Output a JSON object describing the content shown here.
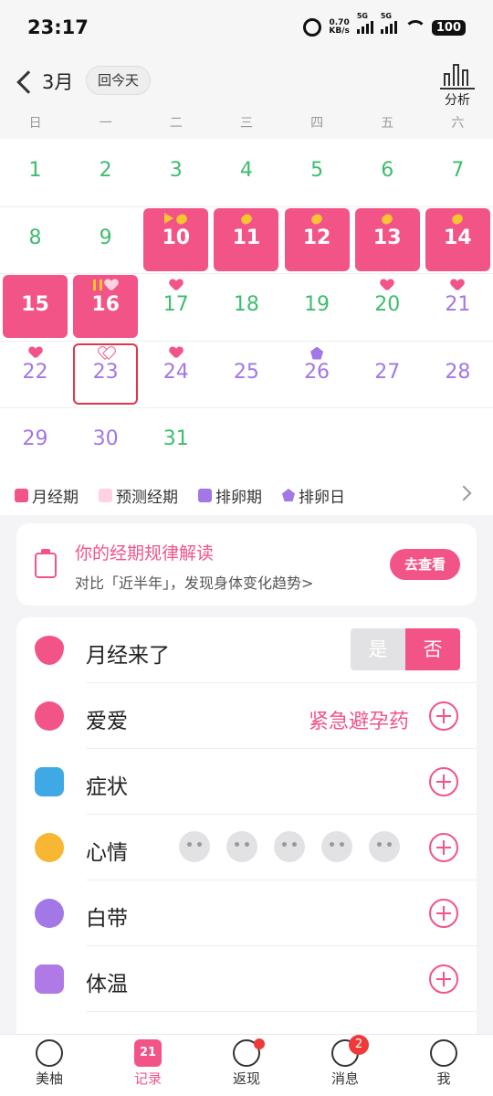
{
  "status_bar": {
    "time": "23:17",
    "speed_value": "0.70",
    "speed_unit": "KB/s",
    "net1": "5G",
    "net2": "5G",
    "battery": "100"
  },
  "header": {
    "month": "3月",
    "today_button": "回今天",
    "analysis_label": "分析"
  },
  "weekdays": [
    "日",
    "一",
    "二",
    "三",
    "四",
    "五",
    "六"
  ],
  "calendar": {
    "days": [
      {
        "d": "1",
        "type": "green"
      },
      {
        "d": "2",
        "type": "green"
      },
      {
        "d": "3",
        "type": "green"
      },
      {
        "d": "4",
        "type": "green"
      },
      {
        "d": "5",
        "type": "green"
      },
      {
        "d": "6",
        "type": "green"
      },
      {
        "d": "7",
        "type": "green"
      },
      {
        "d": "8",
        "type": "green"
      },
      {
        "d": "9",
        "type": "green"
      },
      {
        "d": "10",
        "type": "period",
        "marks": [
          "tri",
          "pill"
        ]
      },
      {
        "d": "11",
        "type": "period",
        "marks": [
          "pill"
        ]
      },
      {
        "d": "12",
        "type": "period",
        "marks": [
          "pill"
        ]
      },
      {
        "d": "13",
        "type": "period",
        "marks": [
          "pill"
        ]
      },
      {
        "d": "14",
        "type": "period",
        "marks": [
          "pill"
        ]
      },
      {
        "d": "15",
        "type": "period"
      },
      {
        "d": "16",
        "type": "period",
        "marks": [
          "pause",
          "heart-light"
        ]
      },
      {
        "d": "17",
        "type": "green",
        "marks": [
          "heart"
        ]
      },
      {
        "d": "18",
        "type": "green"
      },
      {
        "d": "19",
        "type": "green"
      },
      {
        "d": "20",
        "type": "green",
        "marks": [
          "heart"
        ]
      },
      {
        "d": "21",
        "type": "purple",
        "marks": [
          "heart"
        ]
      },
      {
        "d": "22",
        "type": "purple",
        "marks": [
          "heart"
        ]
      },
      {
        "d": "23",
        "type": "purple",
        "marks": [
          "heart-outline"
        ],
        "today": true
      },
      {
        "d": "24",
        "type": "purple",
        "marks": [
          "heart"
        ]
      },
      {
        "d": "25",
        "type": "purple"
      },
      {
        "d": "26",
        "type": "purple",
        "marks": [
          "penta"
        ]
      },
      {
        "d": "27",
        "type": "purple"
      },
      {
        "d": "28",
        "type": "purple"
      },
      {
        "d": "29",
        "type": "purple"
      },
      {
        "d": "30",
        "type": "purple"
      },
      {
        "d": "31",
        "type": "green"
      }
    ]
  },
  "legend": [
    {
      "label": "月经期",
      "color": "#f25487",
      "shape": "square"
    },
    {
      "label": "预测经期",
      "color": "#ffd2e0",
      "shape": "square"
    },
    {
      "label": "排卵期",
      "color": "#a277e6",
      "shape": "square"
    },
    {
      "label": "排卵日",
      "color": "#a277e6",
      "shape": "pentagon"
    }
  ],
  "insight_card": {
    "title": "你的经期规律解读",
    "subtitle": "对比「近半年」，发现身体变化趋势>",
    "button": "去查看"
  },
  "records": {
    "period": {
      "label": "月经来了",
      "yes": "是",
      "no": "否"
    },
    "love": {
      "label": "爱爱",
      "extra": "紧急避孕药"
    },
    "symptoms": {
      "label": "症状"
    },
    "mood": {
      "label": "心情"
    },
    "discharge": {
      "label": "白带"
    },
    "temperature": {
      "label": "体温"
    }
  },
  "nav": [
    {
      "label": "美柚",
      "icon": "meiyou-icon"
    },
    {
      "label": "记录",
      "icon": "calendar-icon",
      "icon_text": "21",
      "active": true
    },
    {
      "label": "返现",
      "icon": "cashback-icon",
      "dot": true
    },
    {
      "label": "消息",
      "icon": "message-icon",
      "badge": "2"
    },
    {
      "label": "我",
      "icon": "profile-icon"
    }
  ],
  "colors": {
    "accent": "#f25487",
    "green": "#3dbd6d",
    "purple": "#a277e6",
    "light_pink": "#ffd2e0"
  }
}
